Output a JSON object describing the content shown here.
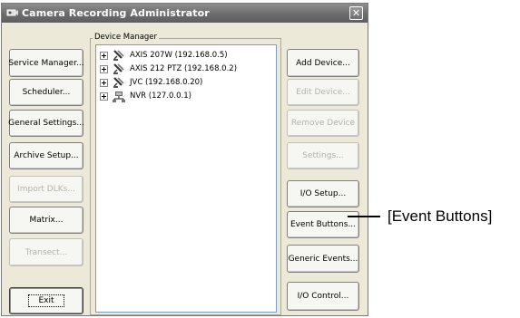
{
  "window": {
    "title": "Camera Recording Administrator",
    "close_label": "✕"
  },
  "left_buttons": [
    {
      "label": "Service Manager...",
      "enabled": true
    },
    {
      "label": "Scheduler...",
      "enabled": true
    },
    {
      "label": "General Settings...",
      "enabled": true
    },
    {
      "label": "Archive Setup...",
      "enabled": true
    },
    {
      "label": "Import DLKs...",
      "enabled": false
    },
    {
      "label": "Matrix...",
      "enabled": true
    },
    {
      "label": "Transect...",
      "enabled": false
    }
  ],
  "exit_button": {
    "label": "Exit"
  },
  "device_manager": {
    "label": "Device Manager",
    "devices": [
      {
        "label": "AXIS 207W (192.168.0.5)",
        "icon": "camera-icon"
      },
      {
        "label": "AXIS 212 PTZ (192.168.0.2)",
        "icon": "camera-icon"
      },
      {
        "label": "JVC  (192.168.0.20)",
        "icon": "camera-icon"
      },
      {
        "label": "NVR (127.0.0.1)",
        "icon": "network-icon"
      }
    ]
  },
  "right_buttons": [
    {
      "label": "Add Device...",
      "enabled": true
    },
    {
      "label": "Edit Device...",
      "enabled": false
    },
    {
      "label": "Remove Device",
      "enabled": false
    },
    {
      "label": "Settings...",
      "enabled": false
    },
    {
      "label": "I/O Setup...",
      "enabled": true
    },
    {
      "label": "Event Buttons...",
      "enabled": true
    },
    {
      "label": "Generic Events...",
      "enabled": true
    },
    {
      "label": "I/O Control...",
      "enabled": true
    }
  ],
  "callout": {
    "text": "[Event Buttons]"
  }
}
